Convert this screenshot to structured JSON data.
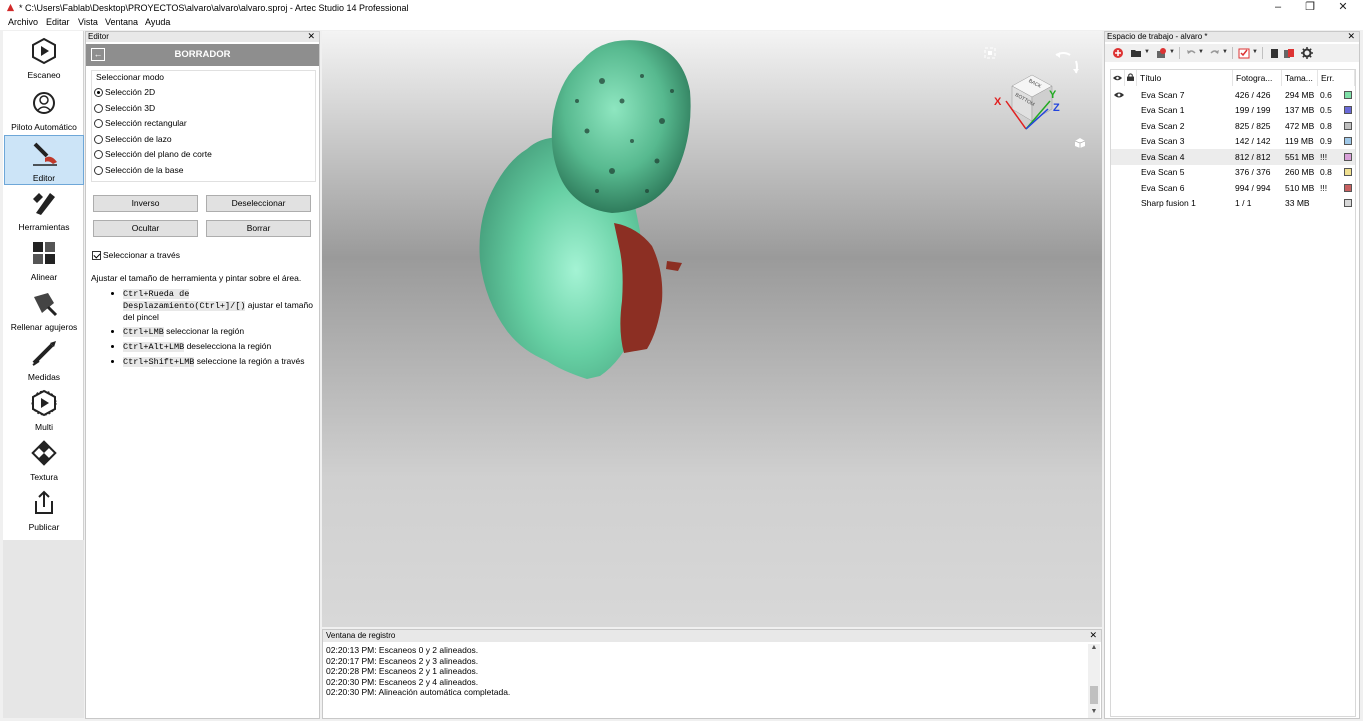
{
  "window": {
    "title": "* C:\\Users\\Fablab\\Desktop\\PROYECTOS\\alvaro\\alvaro\\alvaro.sproj - Artec Studio 14 Professional",
    "minimize": "–",
    "restore": "❐",
    "close": "✕"
  },
  "menu": [
    "Archivo",
    "Editar",
    "Vista",
    "Ventana",
    "Ayuda"
  ],
  "sidebar": {
    "items": [
      {
        "label": "Escaneo",
        "icon": "scan-icon"
      },
      {
        "label": "Piloto Automático",
        "icon": "autopilot-icon"
      },
      {
        "label": "Editor",
        "icon": "eraser-icon",
        "active": true
      },
      {
        "label": "Herramientas",
        "icon": "tools-icon"
      },
      {
        "label": "Alinear",
        "icon": "align-icon"
      },
      {
        "label": "Rellenar agujeros",
        "icon": "fill-holes-icon"
      },
      {
        "label": "Medidas",
        "icon": "measure-icon"
      },
      {
        "label": "Multi",
        "icon": "multi-icon"
      },
      {
        "label": "Textura",
        "icon": "texture-icon"
      },
      {
        "label": "Publicar",
        "icon": "publish-icon"
      }
    ]
  },
  "editor": {
    "panel_title": "Editor",
    "tool_title": "BORRADOR",
    "mode_legend": "Seleccionar modo",
    "modes": [
      {
        "label": "Selección 2D",
        "selected": true
      },
      {
        "label": "Selección 3D",
        "selected": false
      },
      {
        "label": "Selección rectangular",
        "selected": false
      },
      {
        "label": "Selección de lazo",
        "selected": false
      },
      {
        "label": "Selección del plano de corte",
        "selected": false
      },
      {
        "label": "Selección de la base",
        "selected": false
      }
    ],
    "buttons": {
      "inverse": "Inverso",
      "deselect": "Deseleccionar",
      "hide": "Ocultar",
      "erase": "Borrar"
    },
    "select_through": "Seleccionar a través",
    "help_text": "Ajustar el tamaño de herramienta y pintar sobre el área.",
    "help_items": [
      {
        "code": "Ctrl+Rueda de Desplazamiento(Ctrl+]/[)",
        "text": " ajustar el tamaño del pincel"
      },
      {
        "code": "Ctrl+LMB",
        "text": " seleccionar la región"
      },
      {
        "code": "Ctrl+Alt+LMB",
        "text": " deselecciona la región"
      },
      {
        "code": "Ctrl+Shift+LMB",
        "text": " seleccione la región a través"
      }
    ]
  },
  "viewcube": {
    "front": "BACK",
    "side": "BOTTOM",
    "x": "X",
    "y": "Y",
    "z": "Z"
  },
  "log": {
    "title": "Ventana de registro",
    "lines": [
      "02:20:13 PM: Escaneos 0 y 2 alineados.",
      "02:20:17 PM: Escaneos 2 y 3 alineados.",
      "02:20:28 PM: Escaneos 2 y 1 alineados.",
      "02:20:30 PM: Escaneos 2 y 4 alineados.",
      "02:20:30 PM: Alineación automática completada."
    ]
  },
  "workspace": {
    "title": "Espacio de trabajo - alvaro *",
    "columns": [
      "Título",
      "Fotogra...",
      "Tama...",
      "Err."
    ],
    "rows": [
      {
        "title": "Eva Scan 7",
        "frames": "426 / 426",
        "size": "294 MB",
        "err": "0.6",
        "color": "#7fe0a8",
        "visible": true
      },
      {
        "title": "Eva Scan 1",
        "frames": "199 / 199",
        "size": "137 MB",
        "err": "0.5",
        "color": "#6a6ad8",
        "visible": false
      },
      {
        "title": "Eva Scan 2",
        "frames": "825 / 825",
        "size": "472 MB",
        "err": "0.8",
        "color": "#c0c0c0",
        "visible": false
      },
      {
        "title": "Eva Scan 3",
        "frames": "142 / 142",
        "size": "119 MB",
        "err": "0.9",
        "color": "#9fc8e8",
        "visible": false
      },
      {
        "title": "Eva Scan 4",
        "frames": "812 / 812",
        "size": "551 MB",
        "err": "!!!",
        "color": "#d8a0d8",
        "visible": false,
        "selected": true
      },
      {
        "title": "Eva Scan 5",
        "frames": "376 / 376",
        "size": "260 MB",
        "err": "0.8",
        "color": "#f0e090",
        "visible": false
      },
      {
        "title": "Eva Scan 6",
        "frames": "994 / 994",
        "size": "510 MB",
        "err": "!!!",
        "color": "#c86060",
        "visible": false
      },
      {
        "title": "Sharp fusion 1",
        "frames": "1 / 1",
        "size": "33 MB",
        "err": "",
        "color": "#d8d8d8",
        "visible": false
      }
    ]
  },
  "colors": {
    "accent": "#cce4f7",
    "mesh_green": "#6fd1a7",
    "mesh_red": "#8c2f23"
  }
}
